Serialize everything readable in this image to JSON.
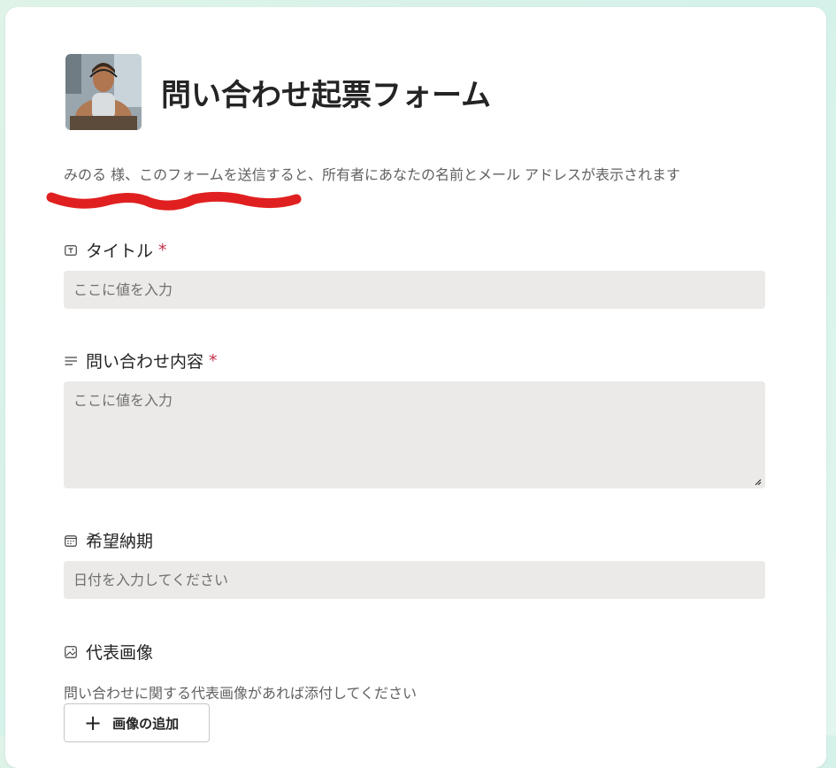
{
  "form": {
    "title": "問い合わせ起票フォーム",
    "notice": "みのる 様、このフォームを送信すると、所有者にあなたの名前とメール アドレスが表示されます"
  },
  "fields": {
    "title": {
      "label": "タイトル",
      "required_mark": "*",
      "placeholder": "ここに値を入力",
      "icon": "text-box-icon"
    },
    "content": {
      "label": "問い合わせ内容",
      "required_mark": "*",
      "placeholder": "ここに値を入力",
      "icon": "text-lines-icon"
    },
    "due_date": {
      "label": "希望納期",
      "placeholder": "日付を入力してください",
      "icon": "calendar-icon"
    },
    "image": {
      "label": "代表画像",
      "help": "問い合わせに関する代表画像があれば添付してください",
      "add_button": "画像の追加",
      "icon": "image-icon"
    }
  },
  "colors": {
    "background": "#d8f3ea",
    "card": "#ffffff",
    "input_bg": "#ebeae8",
    "required": "#c4314b",
    "redaction": "#e02020"
  }
}
